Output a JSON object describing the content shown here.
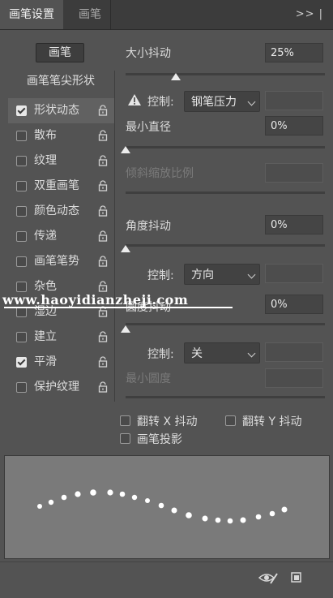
{
  "tabs": {
    "active": "画笔设置",
    "inactive": "画笔"
  },
  "panel_menu": ">> |",
  "brush_button": "画笔",
  "tip_shape": "画笔笔尖形状",
  "sidebar": {
    "items": [
      {
        "label": "形状动态",
        "checked": true,
        "selected": true
      },
      {
        "label": "散布",
        "checked": false,
        "selected": false
      },
      {
        "label": "纹理",
        "checked": false,
        "selected": false
      },
      {
        "label": "双重画笔",
        "checked": false,
        "selected": false
      },
      {
        "label": "颜色动态",
        "checked": false,
        "selected": false
      },
      {
        "label": "传递",
        "checked": false,
        "selected": false
      },
      {
        "label": "画笔笔势",
        "checked": false,
        "selected": false
      },
      {
        "label": "杂色",
        "checked": false,
        "selected": false
      },
      {
        "label": "湿边",
        "checked": false,
        "selected": false
      },
      {
        "label": "建立",
        "checked": false,
        "selected": false
      },
      {
        "label": "平滑",
        "checked": true,
        "selected": false
      },
      {
        "label": "保护纹理",
        "checked": false,
        "selected": false
      }
    ]
  },
  "settings": {
    "size_jitter": {
      "label": "大小抖动",
      "value": "25%",
      "level": 0.25
    },
    "control1": {
      "label": "控制:",
      "value": "钢笔压力"
    },
    "min_diameter": {
      "label": "最小直径",
      "value": "0%",
      "level": 0
    },
    "tilt_scale": {
      "label": "倾斜缩放比例"
    },
    "angle_jitter": {
      "label": "角度抖动",
      "value": "0%",
      "level": 0
    },
    "control2": {
      "label": "控制:",
      "value": "方向"
    },
    "roundness_jitter": {
      "label": "圆度抖动",
      "value": "0%",
      "level": 0
    },
    "control3": {
      "label": "控制:",
      "value": "关"
    },
    "min_roundness": {
      "label": "最小圆度"
    },
    "flip_x": "翻转 X 抖动",
    "flip_y": "翻转 Y 抖动",
    "brush_projection": "画笔投影"
  },
  "watermark": "www.haoyidianzheji.com",
  "colors": {
    "panel": "#535353",
    "tabbar": "#3c3c3c",
    "preview": "#7a7a7a",
    "accent": "#ececec"
  }
}
